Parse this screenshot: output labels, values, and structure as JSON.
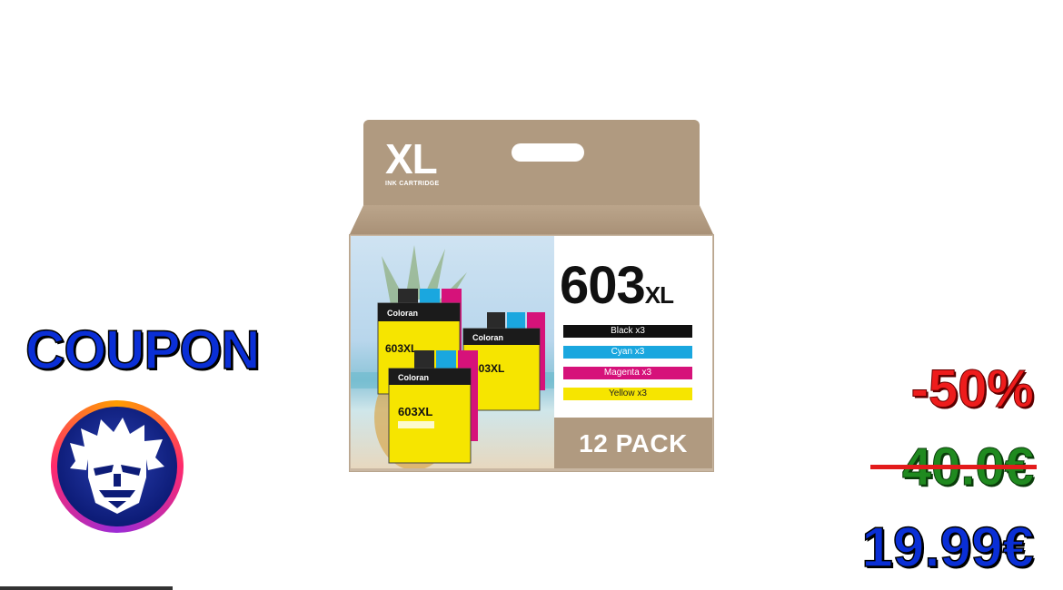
{
  "promo": {
    "coupon_label": "COUPON",
    "discount": "-50%",
    "old_price": "40.0€",
    "new_price": "19.99€"
  },
  "product": {
    "tab_title": "XL",
    "tab_subtitle": "INK CARTRIDGE",
    "model_number": "603",
    "model_suffix": "XL",
    "colors": [
      {
        "label": "Black x3",
        "color": "#111111"
      },
      {
        "label": "Cyan x3",
        "color": "#1aa7df"
      },
      {
        "label": "Magenta x3",
        "color": "#d6127a"
      },
      {
        "label": "Yellow x3",
        "color": "#f6e500"
      }
    ],
    "pack_label": "12 PACK",
    "brand_on_cartridge": "Coloran",
    "cartridge_model": "603XL"
  },
  "colors": {
    "accent_blue": "#0a2fd6",
    "discount_red": "#ee1c1c",
    "old_price_green": "#1f8a1f",
    "box_tan": "#b09a80"
  },
  "icons": {
    "logo": "bearded-face-mascot-icon"
  }
}
